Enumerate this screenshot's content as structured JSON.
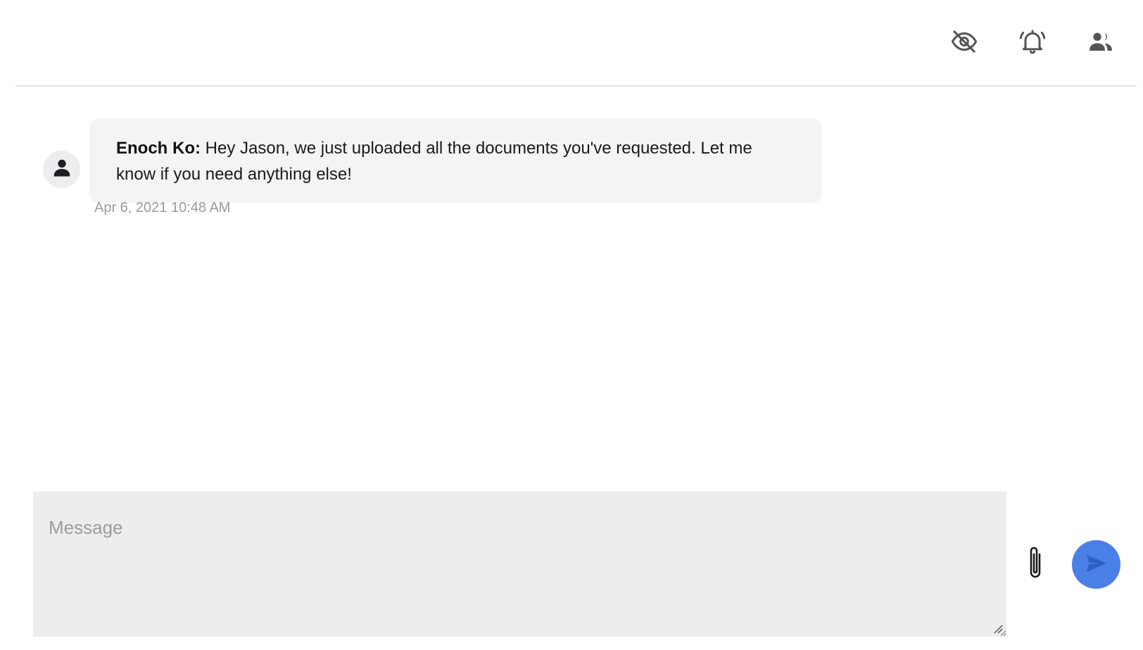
{
  "header": {
    "icons": [
      {
        "name": "eye-off-icon",
        "label": "hide"
      },
      {
        "name": "bell-icon",
        "label": "notifications"
      },
      {
        "name": "people-icon",
        "label": "participants"
      }
    ],
    "icon_color": "#555555"
  },
  "messages": [
    {
      "sender": "Enoch Ko:",
      "text": " Hey Jason, we just uploaded all the documents you've requested. Let me know if you need anything else!",
      "timestamp": "Apr 6, 2021 10:48 AM",
      "avatar_icon": "user-icon"
    }
  ],
  "composer": {
    "placeholder": "Message",
    "value": "",
    "attach_icon": "paperclip-icon",
    "send_icon": "send-icon",
    "send_color": "#4a7fe6"
  }
}
